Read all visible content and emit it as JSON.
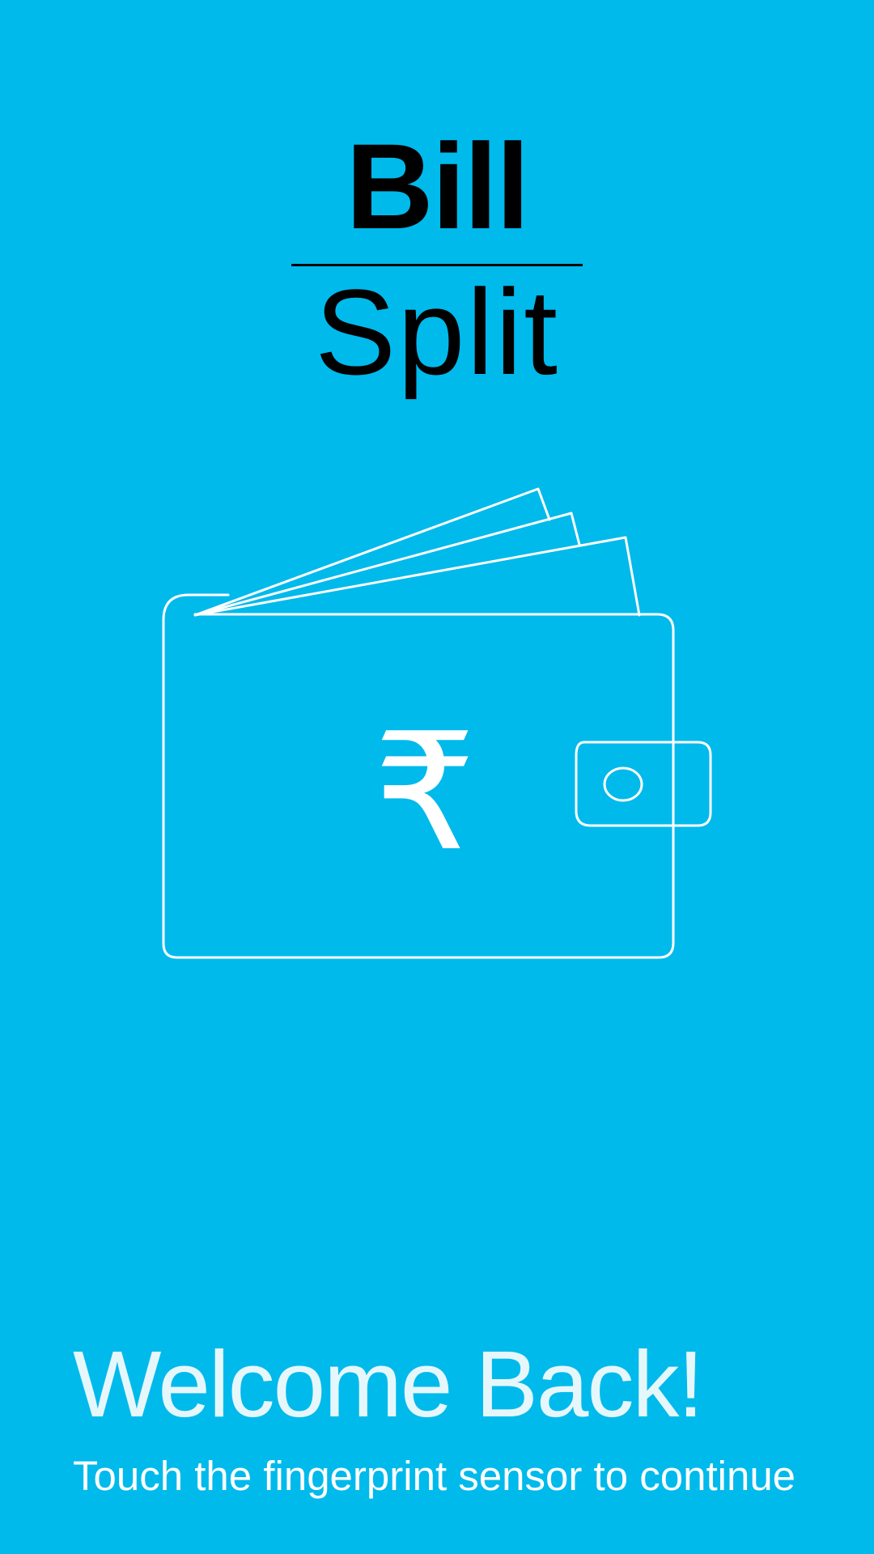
{
  "logo": {
    "word_top": "Bill",
    "word_bottom": "Split"
  },
  "illustration": {
    "icon": "wallet-icon",
    "currency_symbol": "₹"
  },
  "welcome": {
    "title": "Welcome Back!",
    "subtitle": "Touch the fingerprint sensor to continue"
  },
  "colors": {
    "background": "#00BAEC",
    "logo_text": "#000000",
    "line_art": "#FFFFFF"
  }
}
